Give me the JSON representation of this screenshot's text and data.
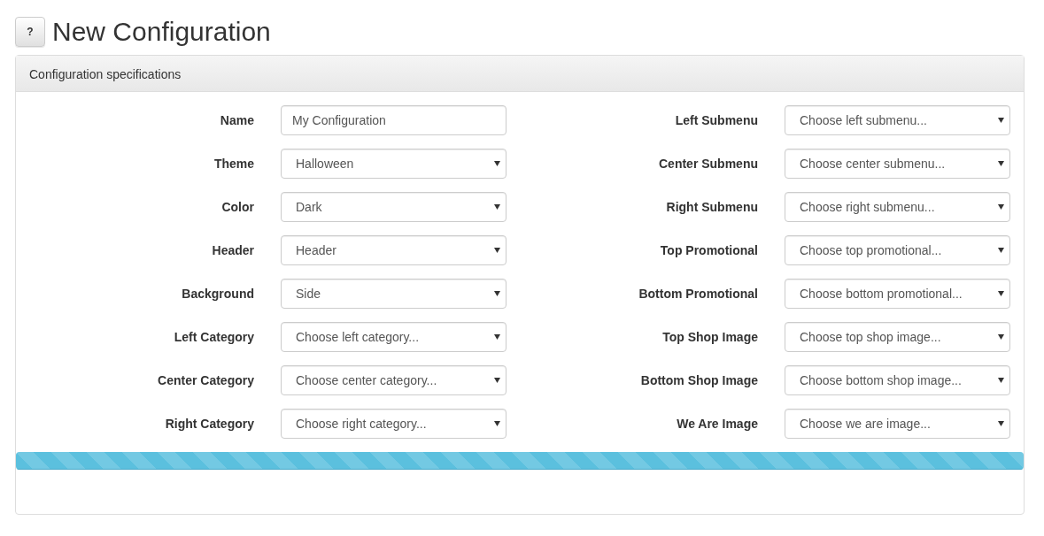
{
  "header": {
    "help_button": "?",
    "title": "New Configuration"
  },
  "panel": {
    "title": "Configuration specifications",
    "columns": [
      [
        {
          "label": "Name",
          "kind": "text",
          "value": "My Configuration"
        },
        {
          "label": "Theme",
          "kind": "select",
          "value": "Halloween"
        },
        {
          "label": "Color",
          "kind": "select",
          "value": "Dark"
        },
        {
          "label": "Header",
          "kind": "select",
          "value": "Header"
        },
        {
          "label": "Background",
          "kind": "select",
          "value": "Side"
        },
        {
          "label": "Left Category",
          "kind": "select",
          "value": "Choose left category..."
        },
        {
          "label": "Center Category",
          "kind": "select",
          "value": "Choose center category..."
        },
        {
          "label": "Right Category",
          "kind": "select",
          "value": "Choose right category..."
        }
      ],
      [
        {
          "label": "Left Submenu",
          "kind": "select",
          "value": "Choose left submenu..."
        },
        {
          "label": "Center Submenu",
          "kind": "select",
          "value": "Choose center submenu..."
        },
        {
          "label": "Right Submenu",
          "kind": "select",
          "value": "Choose right submenu..."
        },
        {
          "label": "Top Promotional",
          "kind": "select",
          "value": "Choose top promotional..."
        },
        {
          "label": "Bottom Promotional",
          "kind": "select",
          "value": "Choose bottom promotional..."
        },
        {
          "label": "Top Shop Image",
          "kind": "select",
          "value": "Choose top shop image..."
        },
        {
          "label": "Bottom Shop Image",
          "kind": "select",
          "value": "Choose bottom shop image..."
        },
        {
          "label": "We Are Image",
          "kind": "select",
          "value": "Choose we are image..."
        }
      ]
    ],
    "progress": {
      "level": 1
    }
  }
}
